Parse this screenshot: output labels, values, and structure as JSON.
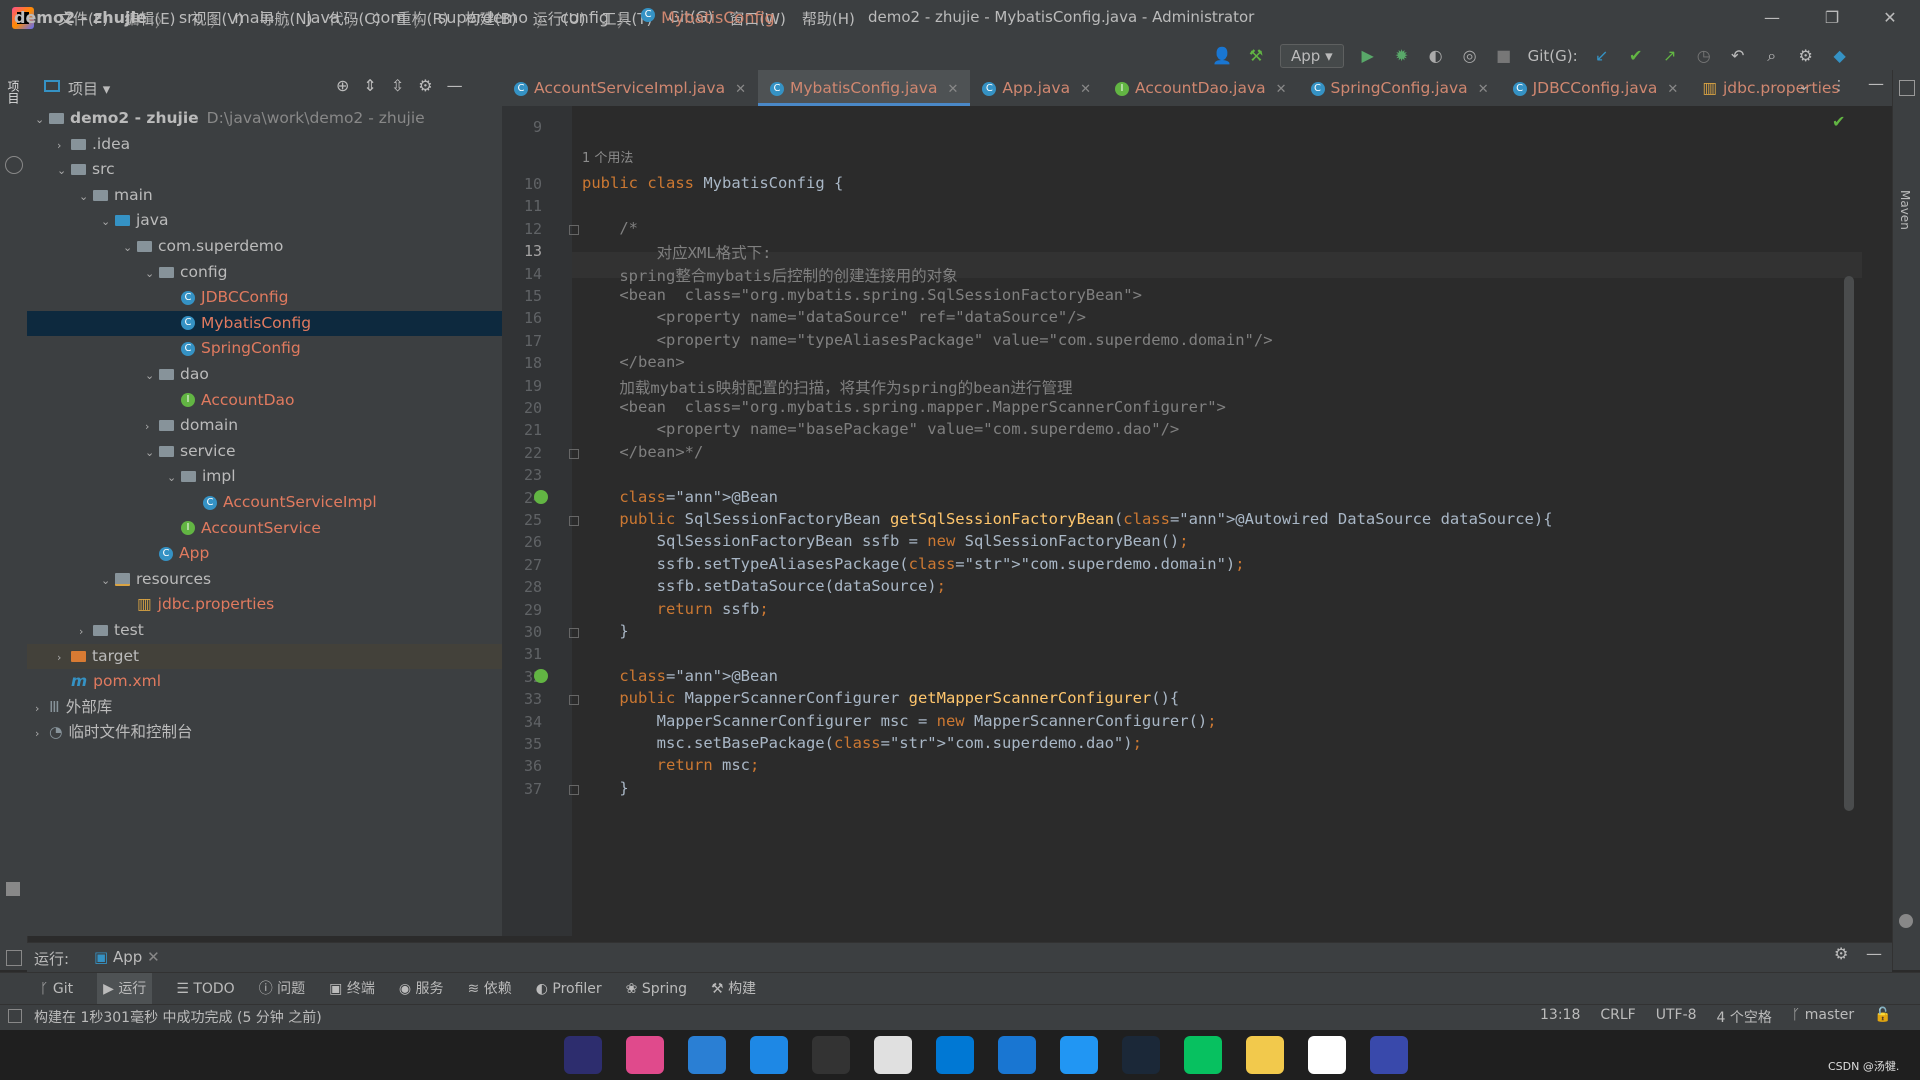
{
  "window": {
    "title": "demo2 - zhujie - MybatisConfig.java - Administrator",
    "menu": [
      "文件(F)",
      "编辑(E)",
      "视图(V)",
      "导航(N)",
      "代码(C)",
      "重构(R)",
      "构建(B)",
      "运行(U)",
      "工具(T)",
      "Git(G)",
      "窗口(W)",
      "帮助(H)"
    ]
  },
  "breadcrumb": [
    "demo2 - zhujie",
    "src",
    "main",
    "java",
    "com",
    "superdemo",
    "config",
    "MybatisConfig"
  ],
  "toolbar": {
    "run_config": "App",
    "git_label": "Git(G):"
  },
  "project": {
    "title": "项目",
    "tree": [
      {
        "label": "demo2 - zhujie",
        "path": "D:\\java\\work\\demo2 - zhujie",
        "depth": 0,
        "expand": "v"
      },
      {
        "label": ".idea",
        "depth": 1,
        "expand": ">"
      },
      {
        "label": "src",
        "depth": 1,
        "expand": "v"
      },
      {
        "label": "main",
        "depth": 2,
        "expand": "v"
      },
      {
        "label": "java",
        "depth": 3,
        "expand": "v"
      },
      {
        "label": "com.superdemo",
        "depth": 4,
        "expand": "v"
      },
      {
        "label": "config",
        "depth": 5,
        "expand": "v"
      },
      {
        "label": "JDBCConfig",
        "depth": 6,
        "expand": ""
      },
      {
        "label": "MybatisConfig",
        "depth": 6,
        "expand": ""
      },
      {
        "label": "SpringConfig",
        "depth": 6,
        "expand": ""
      },
      {
        "label": "dao",
        "depth": 5,
        "expand": "v"
      },
      {
        "label": "AccountDao",
        "depth": 6,
        "expand": ""
      },
      {
        "label": "domain",
        "depth": 5,
        "expand": ">"
      },
      {
        "label": "service",
        "depth": 5,
        "expand": "v"
      },
      {
        "label": "impl",
        "depth": 6,
        "expand": "v"
      },
      {
        "label": "AccountServiceImpl",
        "depth": 7,
        "expand": ""
      },
      {
        "label": "AccountService",
        "depth": 6,
        "expand": ""
      },
      {
        "label": "App",
        "depth": 5,
        "expand": ""
      },
      {
        "label": "resources",
        "depth": 3,
        "expand": "v"
      },
      {
        "label": "jdbc.properties",
        "depth": 4,
        "expand": ""
      },
      {
        "label": "test",
        "depth": 2,
        "expand": ">"
      },
      {
        "label": "target",
        "depth": 1,
        "expand": ">"
      },
      {
        "label": "pom.xml",
        "depth": 1,
        "expand": ""
      },
      {
        "label": "外部库",
        "depth": 0,
        "expand": ">"
      },
      {
        "label": "临时文件和控制台",
        "depth": 0,
        "expand": ">"
      }
    ]
  },
  "tabs": [
    "AccountServiceImpl.java",
    "MybatisConfig.java",
    "App.java",
    "AccountDao.java",
    "SpringConfig.java",
    "JDBCConfig.java",
    "jdbc.properties"
  ],
  "editor": {
    "usage_hint": "1 个用法",
    "lines": [
      {
        "n": "9",
        "t": ""
      },
      {
        "n": "10",
        "t": "public class MybatisConfig {"
      },
      {
        "n": "11",
        "t": ""
      },
      {
        "n": "12",
        "t": "    /*"
      },
      {
        "n": "13",
        "t": "        对应XML格式下:"
      },
      {
        "n": "14",
        "t": "    spring整合mybatis后控制的创建连接用的对象"
      },
      {
        "n": "15",
        "t": "    <bean  class=\"org.mybatis.spring.SqlSessionFactoryBean\">"
      },
      {
        "n": "16",
        "t": "        <property name=\"dataSource\" ref=\"dataSource\"/>"
      },
      {
        "n": "17",
        "t": "        <property name=\"typeAliasesPackage\" value=\"com.superdemo.domain\"/>"
      },
      {
        "n": "18",
        "t": "    </bean>"
      },
      {
        "n": "19",
        "t": "    加载mybatis映射配置的扫描，将其作为spring的bean进行管理"
      },
      {
        "n": "20",
        "t": "    <bean  class=\"org.mybatis.spring.mapper.MapperScannerConfigurer\">"
      },
      {
        "n": "21",
        "t": "        <property name=\"basePackage\" value=\"com.superdemo.dao\"/>"
      },
      {
        "n": "22",
        "t": "    </bean>*/"
      },
      {
        "n": "23",
        "t": ""
      },
      {
        "n": "24",
        "t": "    @Bean"
      },
      {
        "n": "25",
        "t": "    public SqlSessionFactoryBean getSqlSessionFactoryBean(@Autowired DataSource dataSource){"
      },
      {
        "n": "26",
        "t": "        SqlSessionFactoryBean ssfb = new SqlSessionFactoryBean();"
      },
      {
        "n": "27",
        "t": "        ssfb.setTypeAliasesPackage(\"com.superdemo.domain\");"
      },
      {
        "n": "28",
        "t": "        ssfb.setDataSource(dataSource);"
      },
      {
        "n": "29",
        "t": "        return ssfb;"
      },
      {
        "n": "30",
        "t": "    }"
      },
      {
        "n": "31",
        "t": ""
      },
      {
        "n": "32",
        "t": "    @Bean"
      },
      {
        "n": "33",
        "t": "    public MapperScannerConfigurer getMapperScannerConfigurer(){"
      },
      {
        "n": "34",
        "t": "        MapperScannerConfigurer msc = new MapperScannerConfigurer();"
      },
      {
        "n": "35",
        "t": "        msc.setBasePackage(\"com.superdemo.dao\");"
      },
      {
        "n": "36",
        "t": "        return msc;"
      },
      {
        "n": "37",
        "t": "    }"
      }
    ]
  },
  "run": {
    "label": "运行:",
    "config": "App"
  },
  "toolwindows": [
    "Git",
    "运行",
    "TODO",
    "问题",
    "终端",
    "服务",
    "依赖",
    "Profiler",
    "Spring",
    "构建"
  ],
  "status": {
    "message": "构建在 1秒301毫秒 中成功完成 (5 分钟 之前)",
    "position": "13:18",
    "line_sep": "CRLF",
    "encoding": "UTF-8",
    "indent": "4 个空格",
    "branch": "master"
  },
  "taskbar": {
    "right_text": "CSDN @汤犍."
  },
  "side": {
    "left_project": "项目",
    "right_maven": "Maven"
  }
}
